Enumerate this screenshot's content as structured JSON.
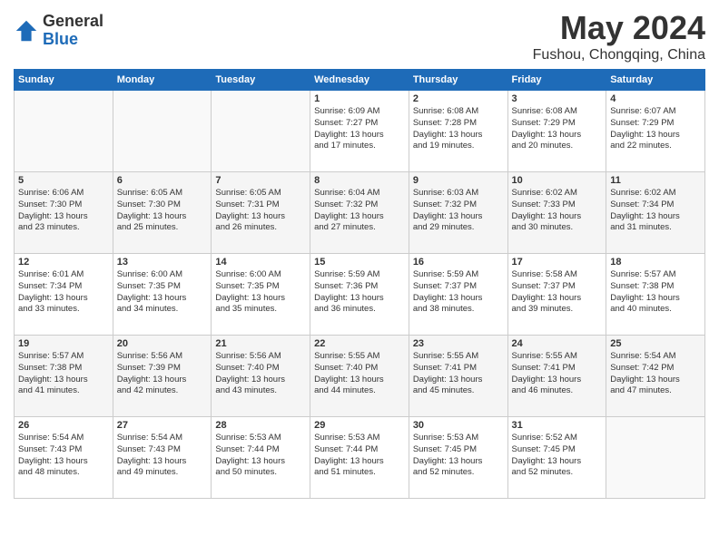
{
  "header": {
    "logo_general": "General",
    "logo_blue": "Blue",
    "month_year": "May 2024",
    "location": "Fushou, Chongqing, China"
  },
  "days_of_week": [
    "Sunday",
    "Monday",
    "Tuesday",
    "Wednesday",
    "Thursday",
    "Friday",
    "Saturday"
  ],
  "weeks": [
    [
      {
        "num": "",
        "info": ""
      },
      {
        "num": "",
        "info": ""
      },
      {
        "num": "",
        "info": ""
      },
      {
        "num": "1",
        "info": "Sunrise: 6:09 AM\nSunset: 7:27 PM\nDaylight: 13 hours\nand 17 minutes."
      },
      {
        "num": "2",
        "info": "Sunrise: 6:08 AM\nSunset: 7:28 PM\nDaylight: 13 hours\nand 19 minutes."
      },
      {
        "num": "3",
        "info": "Sunrise: 6:08 AM\nSunset: 7:29 PM\nDaylight: 13 hours\nand 20 minutes."
      },
      {
        "num": "4",
        "info": "Sunrise: 6:07 AM\nSunset: 7:29 PM\nDaylight: 13 hours\nand 22 minutes."
      }
    ],
    [
      {
        "num": "5",
        "info": "Sunrise: 6:06 AM\nSunset: 7:30 PM\nDaylight: 13 hours\nand 23 minutes."
      },
      {
        "num": "6",
        "info": "Sunrise: 6:05 AM\nSunset: 7:30 PM\nDaylight: 13 hours\nand 25 minutes."
      },
      {
        "num": "7",
        "info": "Sunrise: 6:05 AM\nSunset: 7:31 PM\nDaylight: 13 hours\nand 26 minutes."
      },
      {
        "num": "8",
        "info": "Sunrise: 6:04 AM\nSunset: 7:32 PM\nDaylight: 13 hours\nand 27 minutes."
      },
      {
        "num": "9",
        "info": "Sunrise: 6:03 AM\nSunset: 7:32 PM\nDaylight: 13 hours\nand 29 minutes."
      },
      {
        "num": "10",
        "info": "Sunrise: 6:02 AM\nSunset: 7:33 PM\nDaylight: 13 hours\nand 30 minutes."
      },
      {
        "num": "11",
        "info": "Sunrise: 6:02 AM\nSunset: 7:34 PM\nDaylight: 13 hours\nand 31 minutes."
      }
    ],
    [
      {
        "num": "12",
        "info": "Sunrise: 6:01 AM\nSunset: 7:34 PM\nDaylight: 13 hours\nand 33 minutes."
      },
      {
        "num": "13",
        "info": "Sunrise: 6:00 AM\nSunset: 7:35 PM\nDaylight: 13 hours\nand 34 minutes."
      },
      {
        "num": "14",
        "info": "Sunrise: 6:00 AM\nSunset: 7:35 PM\nDaylight: 13 hours\nand 35 minutes."
      },
      {
        "num": "15",
        "info": "Sunrise: 5:59 AM\nSunset: 7:36 PM\nDaylight: 13 hours\nand 36 minutes."
      },
      {
        "num": "16",
        "info": "Sunrise: 5:59 AM\nSunset: 7:37 PM\nDaylight: 13 hours\nand 38 minutes."
      },
      {
        "num": "17",
        "info": "Sunrise: 5:58 AM\nSunset: 7:37 PM\nDaylight: 13 hours\nand 39 minutes."
      },
      {
        "num": "18",
        "info": "Sunrise: 5:57 AM\nSunset: 7:38 PM\nDaylight: 13 hours\nand 40 minutes."
      }
    ],
    [
      {
        "num": "19",
        "info": "Sunrise: 5:57 AM\nSunset: 7:38 PM\nDaylight: 13 hours\nand 41 minutes."
      },
      {
        "num": "20",
        "info": "Sunrise: 5:56 AM\nSunset: 7:39 PM\nDaylight: 13 hours\nand 42 minutes."
      },
      {
        "num": "21",
        "info": "Sunrise: 5:56 AM\nSunset: 7:40 PM\nDaylight: 13 hours\nand 43 minutes."
      },
      {
        "num": "22",
        "info": "Sunrise: 5:55 AM\nSunset: 7:40 PM\nDaylight: 13 hours\nand 44 minutes."
      },
      {
        "num": "23",
        "info": "Sunrise: 5:55 AM\nSunset: 7:41 PM\nDaylight: 13 hours\nand 45 minutes."
      },
      {
        "num": "24",
        "info": "Sunrise: 5:55 AM\nSunset: 7:41 PM\nDaylight: 13 hours\nand 46 minutes."
      },
      {
        "num": "25",
        "info": "Sunrise: 5:54 AM\nSunset: 7:42 PM\nDaylight: 13 hours\nand 47 minutes."
      }
    ],
    [
      {
        "num": "26",
        "info": "Sunrise: 5:54 AM\nSunset: 7:43 PM\nDaylight: 13 hours\nand 48 minutes."
      },
      {
        "num": "27",
        "info": "Sunrise: 5:54 AM\nSunset: 7:43 PM\nDaylight: 13 hours\nand 49 minutes."
      },
      {
        "num": "28",
        "info": "Sunrise: 5:53 AM\nSunset: 7:44 PM\nDaylight: 13 hours\nand 50 minutes."
      },
      {
        "num": "29",
        "info": "Sunrise: 5:53 AM\nSunset: 7:44 PM\nDaylight: 13 hours\nand 51 minutes."
      },
      {
        "num": "30",
        "info": "Sunrise: 5:53 AM\nSunset: 7:45 PM\nDaylight: 13 hours\nand 52 minutes."
      },
      {
        "num": "31",
        "info": "Sunrise: 5:52 AM\nSunset: 7:45 PM\nDaylight: 13 hours\nand 52 minutes."
      },
      {
        "num": "",
        "info": ""
      }
    ]
  ]
}
